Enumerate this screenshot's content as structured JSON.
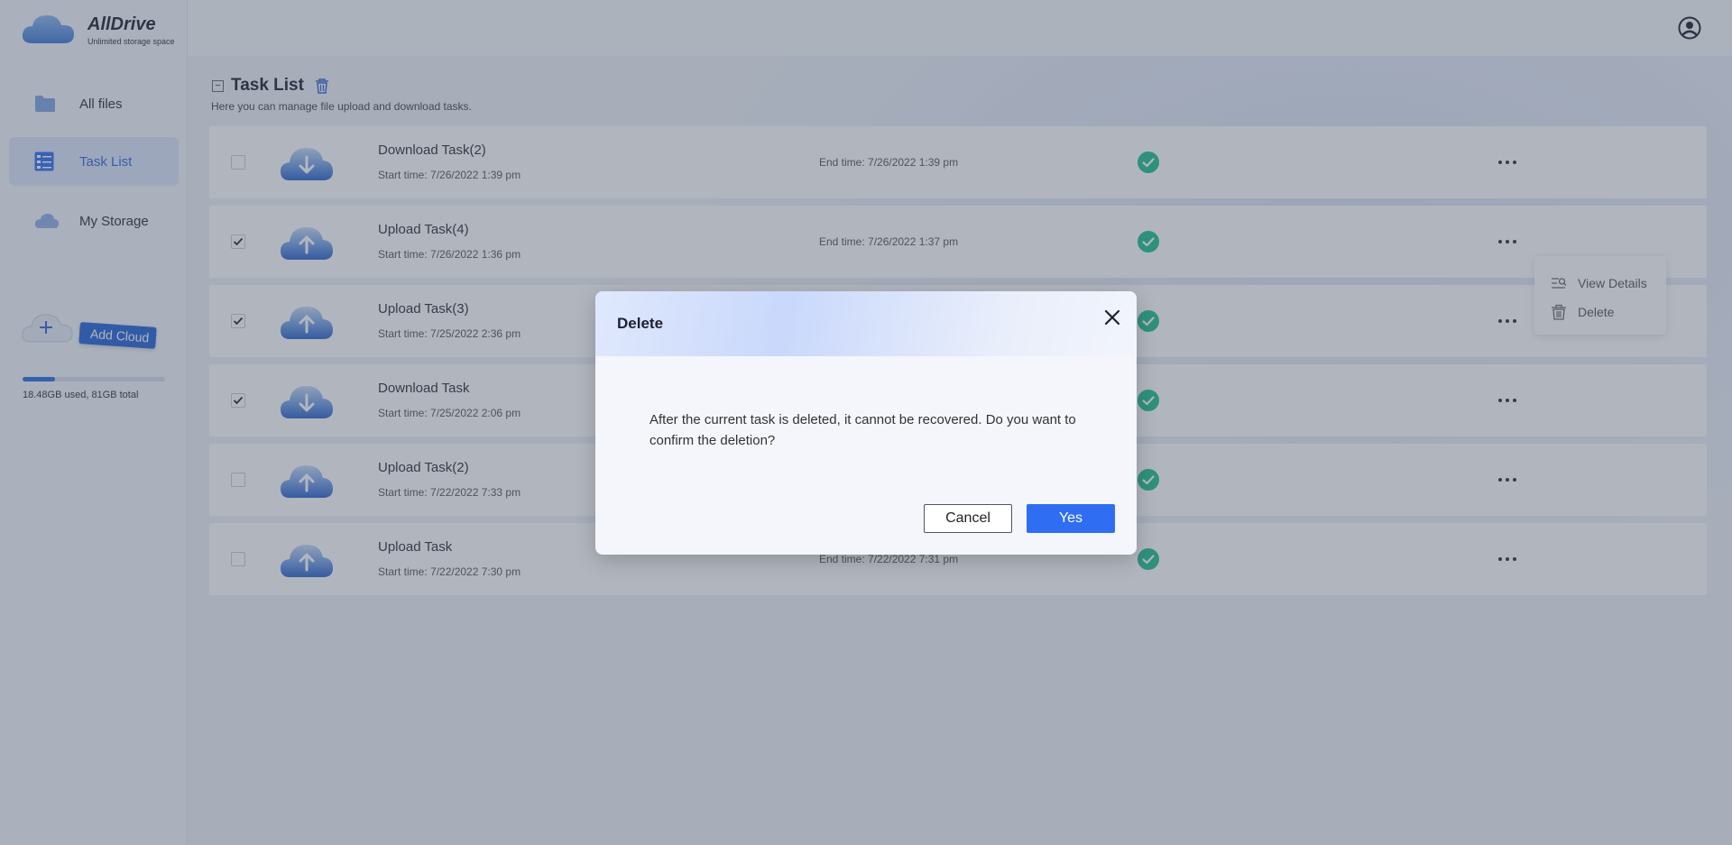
{
  "app": {
    "name": "AllDrive",
    "tagline": "Unlimited storage space"
  },
  "sidebar": {
    "items": [
      {
        "label": "All files",
        "icon": "folder-icon"
      },
      {
        "label": "Task List",
        "icon": "task-list-icon",
        "active": true
      },
      {
        "label": "My Storage",
        "icon": "cloud-icon"
      }
    ],
    "add_cloud_label": "Add Cloud",
    "storage": {
      "text": "18.48GB used, 81GB total",
      "used_fraction": 0.228
    }
  },
  "main": {
    "title": "Task List",
    "subtitle": "Here you can manage file upload and download tasks.",
    "tasks": [
      {
        "name": "Download Task(2)",
        "start": "Start time: 7/26/2022 1:39 pm",
        "end": "End time: 7/26/2022 1:39 pm",
        "type": "download",
        "checked": false
      },
      {
        "name": "Upload Task(4)",
        "start": "Start time: 7/26/2022 1:36 pm",
        "end": "End time: 7/26/2022 1:37 pm",
        "type": "upload",
        "checked": true
      },
      {
        "name": "Upload Task(3)",
        "start": "Start time: 7/25/2022 2:36 pm",
        "end": "",
        "type": "upload",
        "checked": true
      },
      {
        "name": "Download Task",
        "start": "Start time: 7/25/2022 2:06 pm",
        "end": "",
        "type": "download",
        "checked": true
      },
      {
        "name": "Upload Task(2)",
        "start": "Start time: 7/22/2022 7:33 pm",
        "end": "",
        "type": "upload",
        "checked": false
      },
      {
        "name": "Upload Task",
        "start": "Start time: 7/22/2022 7:30 pm",
        "end": "End time: 7/22/2022 7:31 pm",
        "type": "upload",
        "checked": false
      }
    ]
  },
  "context_menu": {
    "view_details": "View Details",
    "delete": "Delete"
  },
  "dialog": {
    "title": "Delete",
    "message": "After the current task is deleted, it cannot be recovered. Do you want to confirm the deletion?",
    "cancel": "Cancel",
    "confirm": "Yes"
  },
  "colors": {
    "accent": "#2f6ef2",
    "success": "#1fbf8f",
    "brand_tag": "#2563d8"
  }
}
